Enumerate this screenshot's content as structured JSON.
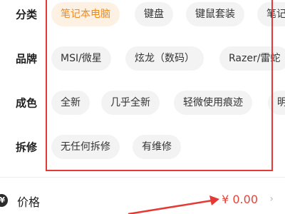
{
  "filters": {
    "category": {
      "label": "分类",
      "options": [
        "笔记本电脑",
        "键盘",
        "键鼠套装",
        "笔记"
      ],
      "selected": "笔记本电脑"
    },
    "brand": {
      "label": "品牌",
      "options": [
        "MSI/微星",
        "炫龙（数码）",
        "Razer/雷蛇"
      ]
    },
    "condition": {
      "label": "成色",
      "options": [
        "全新",
        "几乎全新",
        "轻微使用痕迹",
        "明"
      ]
    },
    "repair": {
      "label": "拆修",
      "options": [
        "无任何拆修",
        "有维修"
      ]
    }
  },
  "price": {
    "icon_text": "¥",
    "label": "价格",
    "value": "¥ 0.00",
    "chevron": "›"
  },
  "annotation": {
    "box_color": "#e53935",
    "arrow_color": "#e53935"
  },
  "colors": {
    "accent": "#f08a1c",
    "accent_bg": "#fdf1e3",
    "price": "#e8433a"
  }
}
